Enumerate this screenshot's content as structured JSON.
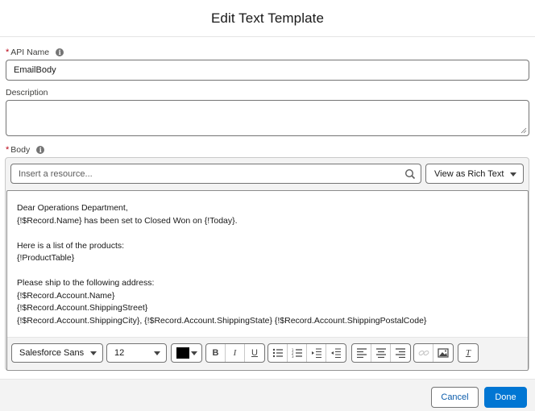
{
  "modal": {
    "title": "Edit Text Template"
  },
  "api_name": {
    "required_mark": "*",
    "label": "API Name",
    "value": "EmailBody"
  },
  "description": {
    "label": "Description",
    "value": ""
  },
  "body": {
    "required_mark": "*",
    "label": "Body",
    "resource_placeholder": "Insert a resource...",
    "view_mode": "View as Rich Text",
    "content_lines": [
      "Dear Operations Department,",
      "{!$Record.Name} has been set to Closed Won on {!Today}.",
      "",
      "Here is a list of the products:",
      "{!ProductTable}",
      "",
      "Please ship to the following address:",
      "{!$Record.Account.Name}",
      "{!$Record.Account.ShippingStreet}",
      "{!$Record.Account.ShippingCity}, {!$Record.Account.ShippingState} {!$Record.Account.ShippingPostalCode}"
    ]
  },
  "toolbar": {
    "font_family": "Salesforce Sans",
    "font_size": "12",
    "text_color": "#000000",
    "bold": "B",
    "italic": "I",
    "underline": "U",
    "clear_format": "T"
  },
  "footer": {
    "cancel_label": "Cancel",
    "done_label": "Done"
  },
  "colors": {
    "brand": "#0176d3",
    "required": "#ba0517"
  },
  "icons": {
    "info": "info-icon",
    "search": "search-icon",
    "chevron": "chevron-down-icon"
  }
}
